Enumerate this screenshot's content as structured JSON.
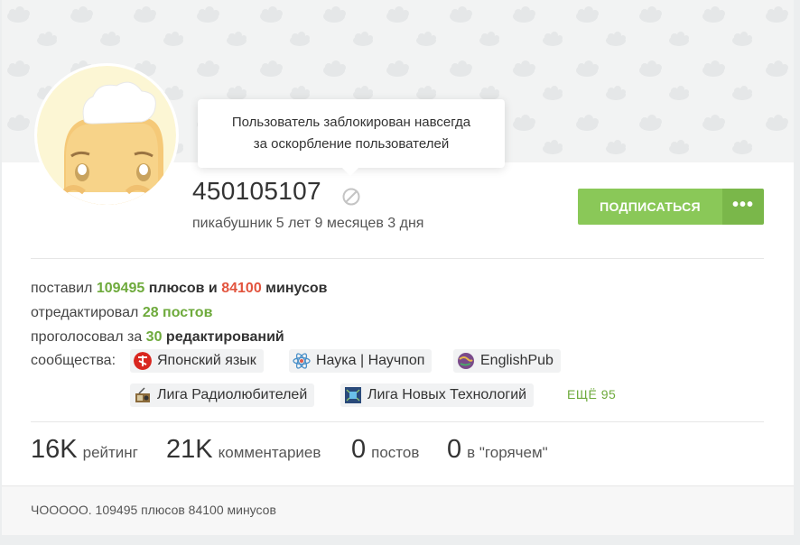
{
  "tooltip": {
    "line1": "Пользователь заблокирован навсегда",
    "line2": "за оскорбление пользователей"
  },
  "profile": {
    "username": "450105107",
    "age_text": "пикабушник 5 лет 9 месяцев 3 дня",
    "ban_icon": "ban-icon"
  },
  "actions": {
    "subscribe_label": "ПОДПИСАТЬСЯ",
    "more_label": "•••"
  },
  "stats": {
    "line1_prefix": "поставил",
    "pluses": "109495",
    "line1_mid": "плюсов и",
    "minuses": "84100",
    "line1_suffix": "минусов",
    "line2_prefix": "отредактировал",
    "edited_posts": "28 постов",
    "line3_prefix": "проголосовал за",
    "voted_count": "30",
    "line3_suffix": "редактирований"
  },
  "communities": {
    "label": "сообщества:",
    "items": [
      {
        "name": "Японский язык",
        "icon": "japanese-icon"
      },
      {
        "name": "Наука | Научпоп",
        "icon": "atom-icon"
      },
      {
        "name": "EnglishPub",
        "icon": "globe-icon"
      },
      {
        "name": "Лига Радиолюбителей",
        "icon": "radio-icon"
      },
      {
        "name": "Лига Новых Технологий",
        "icon": "chip-icon"
      }
    ],
    "more": "ЕЩЁ 95"
  },
  "metrics": [
    {
      "value": "16K",
      "label": "рейтинг"
    },
    {
      "value": "21K",
      "label": "комментариев"
    },
    {
      "value": "0",
      "label": "постов"
    },
    {
      "value": "0",
      "label": "в \"горячем\""
    }
  ],
  "footer": {
    "note": "ЧООООО. 109495 плюсов 84100 минусов"
  },
  "colors": {
    "accent_green": "#8ac858",
    "plus_green": "#6eaa3c",
    "minus_red": "#e2543e"
  }
}
